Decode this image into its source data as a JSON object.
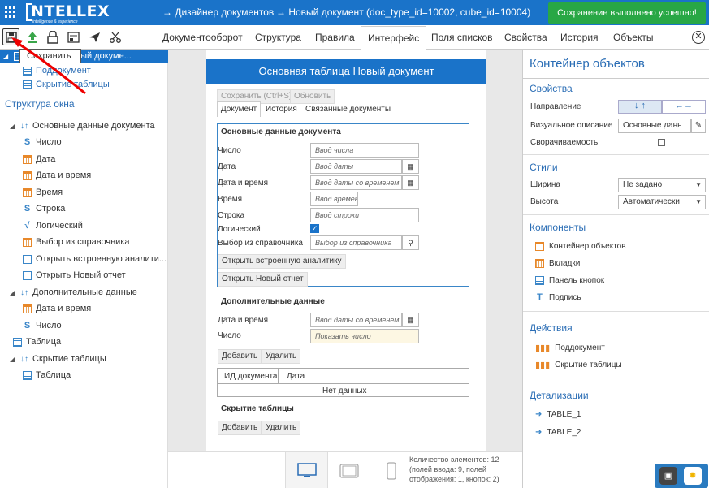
{
  "header": {
    "logo": "NTELLEX",
    "logo_sub": "intelligence & experience",
    "crumb1": "→ Дизайнер документов",
    "crumb2": "→ Новый документ (doc_type_id=10002, cube_id=10004)",
    "toast": "Сохранение выполнено успешно!"
  },
  "toolbar": {
    "tooltip": "Сохранить",
    "tabs": [
      "Документооборот",
      "Структура",
      "Правила",
      "Интерфейс",
      "Поля списков",
      "Свойства",
      "История",
      "Объекты"
    ]
  },
  "left": {
    "tree_top": [
      "Таблица Новый докуме...",
      "Поддокумент",
      "Скрытие таблицы"
    ],
    "section": "Структура окна",
    "items": [
      "Основные данные документа",
      "Число",
      "Дата",
      "Дата и время",
      "Время",
      "Строка",
      "Логический",
      "Выбор из справочника",
      "Открыть встроенную аналити...",
      "Открыть Новый отчет",
      "Дополнительные данные",
      "Дата и время",
      "Число",
      "Таблица",
      "Скрытие таблицы",
      "Таблица"
    ]
  },
  "doc": {
    "title": "Основная таблица Новый документ",
    "save": "Сохранить (Ctrl+S)",
    "refresh": "Обновить",
    "tabs": [
      "Документ",
      "История",
      "Связанные документы"
    ],
    "group1": "Основные данные документа",
    "labels": [
      "Число",
      "Дата",
      "Дата и время",
      "Время",
      "Строка",
      "Логический",
      "Выбор из справочника"
    ],
    "placeholders": [
      "Ввод числа",
      "Ввод даты",
      "Ввод даты со временем",
      "Ввод времени",
      "Ввод строки",
      "Выбор из справочника"
    ],
    "btn_analytics": "Открыть встроенную аналитику",
    "btn_report": "Открыть Новый отчет",
    "group2": "Дополнительные данные",
    "g2_labels": [
      "Дата и время",
      "Число"
    ],
    "g2_ph": [
      "Ввод даты со временем",
      "Показать число"
    ],
    "add": "Добавить",
    "del": "Удалить",
    "col1": "ИД документа",
    "col2": "Дата",
    "empty": "Нет данных",
    "group3": "Скрытие таблицы"
  },
  "status": [
    "Количество элементов: 12",
    "(полей ввода: 9, полей",
    "отображения: 1, кнопок: 2)"
  ],
  "right": {
    "title": "Контейнер объектов",
    "props": "Свойства",
    "dir": "Направление",
    "vis": "Визуальное описание",
    "vis_val": "Основные данн",
    "collapse": "Сворачиваемость",
    "styles": "Стили",
    "width": "Ширина",
    "width_val": "Не задано",
    "height": "Высота",
    "height_val": "Автоматически",
    "components": "Компоненты",
    "comp": [
      "Контейнер объектов",
      "Вкладки",
      "Панель кнопок",
      "Подпись"
    ],
    "actions": "Действия",
    "act": [
      "Поддокумент",
      "Скрытие таблицы"
    ],
    "detail": "Детализации",
    "det": [
      "TABLE_1",
      "TABLE_2"
    ]
  }
}
